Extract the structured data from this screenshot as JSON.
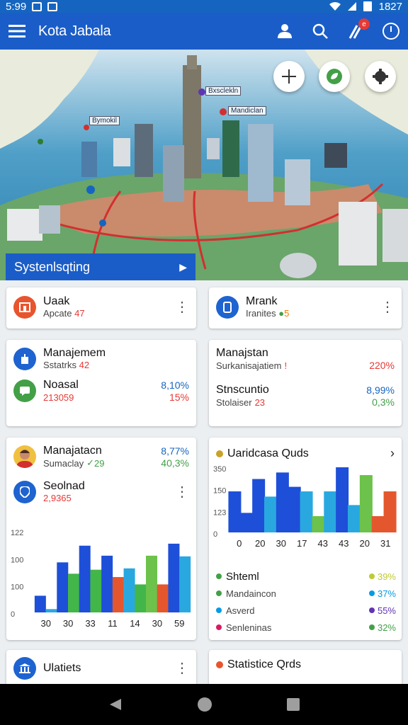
{
  "status_bar": {
    "time": "5:99",
    "right_text": "1827"
  },
  "app_bar": {
    "title": "Kota Jabala",
    "badge": "e"
  },
  "map": {
    "labels": [
      "Bxsclekln",
      "Mandiclan",
      "Bymokil"
    ],
    "banner": "Systenlsqting"
  },
  "cards": {
    "uaak": {
      "title": "Uaak",
      "sub": "Apcate",
      "value": "47"
    },
    "mrank": {
      "title": "Mrank",
      "sub": "Iranites",
      "value": "5"
    },
    "manajemem": {
      "title": "Manajemem",
      "sub": "Sstatrks",
      "value": "42",
      "row2_title": "Noasal",
      "row2_pct": "8,10%",
      "row2_sub": "213059",
      "row2_sub_pct": "15%"
    },
    "manajstan": {
      "title": "Manajstan",
      "sub": "Surkanisajatiem",
      "value": "!",
      "pct": "220%",
      "row2_title": "Stnscuntio",
      "row2_pct": "8,99%",
      "row2_sub": "Stolaiser",
      "row2_sub_value": "23",
      "row2_sub_pct": "0,3%"
    },
    "manajatacn": {
      "title": "Manajatacn",
      "sub": "Sumaclay",
      "sub_value": "29",
      "pct": "8,77%",
      "sub_pct": "40,3%",
      "seoinad_title": "Seolnad",
      "seoinad_value": "2,9365"
    },
    "uaridcasa": {
      "title": "Uaridcasa Quds",
      "legend": [
        {
          "label": "Shteml",
          "pct": "39%",
          "color": "#43a047",
          "pct_color": "#c0ca33"
        },
        {
          "label": "Mandaincon",
          "pct": "37%",
          "color": "#43a047",
          "pct_color": "#039be5"
        },
        {
          "label": "Asverd",
          "pct": "55%",
          "color": "#039be5",
          "pct_color": "#5e35b1"
        },
        {
          "label": "Senleninas",
          "pct": "32%",
          "color": "#d81b60",
          "pct_color": "#43a047"
        }
      ]
    },
    "ulatiets": {
      "title": "Ulatiets"
    },
    "statistice": {
      "title": "Statistice Qrds"
    }
  },
  "chart_data": [
    {
      "type": "bar",
      "title": "Seolnad",
      "categories": [
        "30",
        "30",
        "33",
        "11",
        "14",
        "30",
        "59"
      ],
      "y_ticks": [
        "122",
        "100",
        "100",
        "0"
      ],
      "values": [
        25,
        5,
        75,
        58,
        100,
        64,
        85,
        53,
        66,
        42,
        85,
        42,
        103,
        84
      ],
      "bar_colors": [
        "#1e4fd8",
        "#29a8e0",
        "#1e4fd8",
        "#43b649",
        "#1e4fd8",
        "#43b649",
        "#1e4fd8",
        "#e4572e",
        "#29a8e0",
        "#43b649",
        "#6cc24a",
        "#e4572e"
      ],
      "ylim": [
        0,
        122
      ]
    },
    {
      "type": "bar",
      "title": "Uaridcasa Quds",
      "categories": [
        "0",
        "20",
        "30",
        "17",
        "43",
        "43",
        "20",
        "31"
      ],
      "y_ticks": [
        "350",
        "150",
        "123",
        "0"
      ],
      "values": [
        63,
        30,
        82,
        55,
        92,
        70,
        63,
        25,
        63,
        100,
        42,
        88,
        25,
        63
      ],
      "bar_colors": [
        "#1e4fd8",
        "#1e4fd8",
        "#1e4fd8",
        "#29a8e0",
        "#1e4fd8",
        "#1e4fd8",
        "#29a8e0",
        "#6cc24a",
        "#29a8e0",
        "#1e4fd8",
        "#29a8e0",
        "#6cc24a",
        "#e4572e",
        "#e4572e"
      ],
      "ylim": [
        0,
        100
      ]
    }
  ]
}
